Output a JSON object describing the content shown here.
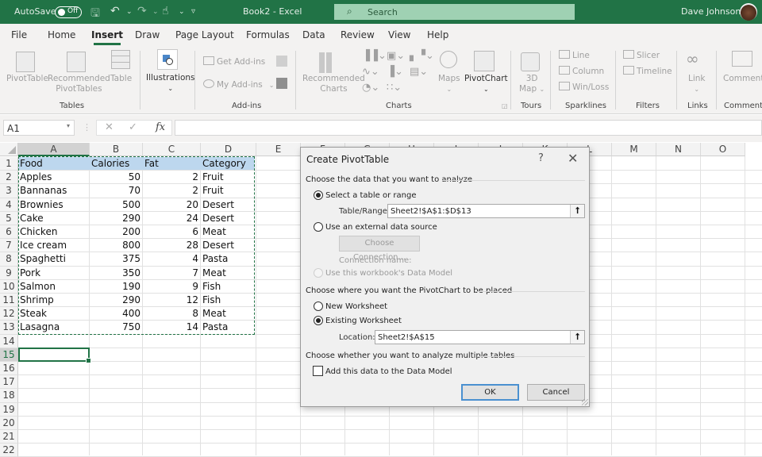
{
  "titlebar": {
    "autosave_label": "AutoSave",
    "autosave_state": "Off",
    "document_title": "Book2  -  Excel",
    "search_placeholder": "Search",
    "user_name": "Dave Johnson"
  },
  "menu": {
    "tabs": [
      {
        "label": "File"
      },
      {
        "label": "Home"
      },
      {
        "label": "Insert",
        "active": true
      },
      {
        "label": "Draw"
      },
      {
        "label": "Page Layout"
      },
      {
        "label": "Formulas"
      },
      {
        "label": "Data"
      },
      {
        "label": "Review"
      },
      {
        "label": "View"
      },
      {
        "label": "Help"
      }
    ]
  },
  "ribbon": {
    "groups": {
      "tables": "Tables",
      "illustrations": "",
      "addins": "Add-ins",
      "charts": "Charts",
      "tours": "Tours",
      "sparklines": "Sparklines",
      "filters": "Filters",
      "links": "Links",
      "comments": "Comments"
    },
    "buttons": {
      "pivottable": "PivotTable",
      "recommended_pivottables_1": "Recommended",
      "recommended_pivottables_2": "PivotTables",
      "table": "Table",
      "illustrations": "Illustrations",
      "get_addins": "Get Add-ins",
      "my_addins": "My Add-ins",
      "recommended_charts_1": "Recommended",
      "recommended_charts_2": "Charts",
      "maps": "Maps",
      "pivotchart": "PivotChart",
      "map3d_1": "3D",
      "map3d_2": "Map",
      "line": "Line",
      "column": "Column",
      "winloss": "Win/Loss",
      "slicer": "Slicer",
      "timeline": "Timeline",
      "link": "Link",
      "comment": "Comment"
    }
  },
  "formula_bar": {
    "name_box": "A1",
    "fx_label": "fx",
    "formula": ""
  },
  "sheet": {
    "columns": [
      "A",
      "B",
      "C",
      "D",
      "E",
      "F",
      "G",
      "H",
      "I",
      "J",
      "K",
      "L",
      "M",
      "N",
      "O"
    ],
    "row_numbers": [
      "1",
      "2",
      "3",
      "4",
      "5",
      "6",
      "7",
      "8",
      "9",
      "10",
      "11",
      "12",
      "13",
      "14",
      "15",
      "16",
      "17",
      "18",
      "19",
      "20",
      "21",
      "22"
    ],
    "headers": [
      "Food",
      "Calories",
      "Fat",
      "Category"
    ],
    "rows": [
      [
        "Apples",
        "50",
        "2",
        "Fruit"
      ],
      [
        "Bannanas",
        "70",
        "2",
        "Fruit"
      ],
      [
        "Brownies",
        "500",
        "20",
        "Desert"
      ],
      [
        "Cake",
        "290",
        "24",
        "Desert"
      ],
      [
        "Chicken",
        "200",
        "6",
        "Meat"
      ],
      [
        "Ice cream",
        "800",
        "28",
        "Desert"
      ],
      [
        "Spaghetti",
        "375",
        "4",
        "Pasta"
      ],
      [
        "Pork",
        "350",
        "7",
        "Meat"
      ],
      [
        "Salmon",
        "190",
        "9",
        "Fish"
      ],
      [
        "Shrimp",
        "290",
        "12",
        "Fish"
      ],
      [
        "Steak",
        "400",
        "8",
        "Meat"
      ],
      [
        "Lasagna",
        "750",
        "14",
        "Pasta"
      ]
    ],
    "active_cell": "A15"
  },
  "dialog": {
    "title": "Create PivotTable",
    "help": "?",
    "section_data": "Choose the data that you want to analyze",
    "opt_select_range": "Select a table or range",
    "table_range_label": "Table/Range:",
    "table_range_value": "Sheet2!$A$1:$D$13",
    "opt_external": "Use an external data source",
    "choose_connection": "Choose Connection...",
    "connection_name_label": "Connection name:",
    "opt_data_model": "Use this workbook's Data Model",
    "section_placement": "Choose where you want the PivotChart to be placed",
    "opt_new_worksheet": "New Worksheet",
    "opt_existing_worksheet": "Existing Worksheet",
    "location_label": "Location:",
    "location_value": "Sheet2!$A$15",
    "section_multiple": "Choose whether you want to analyze multiple tables",
    "add_to_data_model": "Add this data to the Data Model",
    "add_to_data_model_checked": false,
    "selected_source": "table_or_range",
    "selected_placement": "existing_worksheet",
    "ok_label": "OK",
    "cancel_label": "Cancel"
  }
}
